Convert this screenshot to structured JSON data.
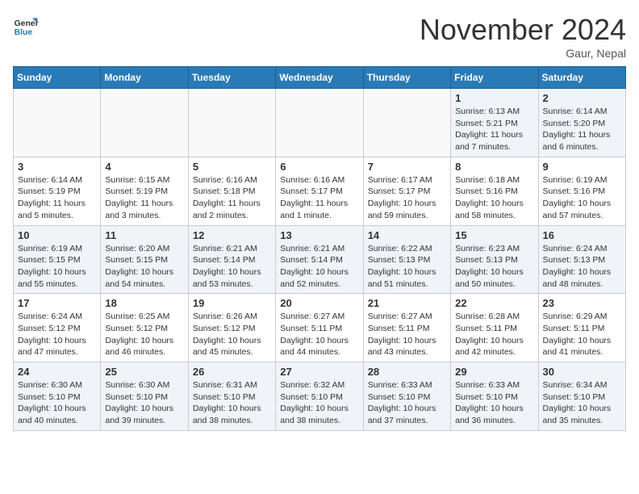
{
  "header": {
    "logo_general": "General",
    "logo_blue": "Blue",
    "month_title": "November 2024",
    "location": "Gaur, Nepal"
  },
  "weekdays": [
    "Sunday",
    "Monday",
    "Tuesday",
    "Wednesday",
    "Thursday",
    "Friday",
    "Saturday"
  ],
  "weeks": [
    [
      {
        "day": "",
        "empty": true
      },
      {
        "day": "",
        "empty": true
      },
      {
        "day": "",
        "empty": true
      },
      {
        "day": "",
        "empty": true
      },
      {
        "day": "",
        "empty": true
      },
      {
        "day": "1",
        "sunrise": "Sunrise: 6:13 AM",
        "sunset": "Sunset: 5:21 PM",
        "daylight": "Daylight: 11 hours and 7 minutes."
      },
      {
        "day": "2",
        "sunrise": "Sunrise: 6:14 AM",
        "sunset": "Sunset: 5:20 PM",
        "daylight": "Daylight: 11 hours and 6 minutes."
      }
    ],
    [
      {
        "day": "3",
        "sunrise": "Sunrise: 6:14 AM",
        "sunset": "Sunset: 5:19 PM",
        "daylight": "Daylight: 11 hours and 5 minutes."
      },
      {
        "day": "4",
        "sunrise": "Sunrise: 6:15 AM",
        "sunset": "Sunset: 5:19 PM",
        "daylight": "Daylight: 11 hours and 3 minutes."
      },
      {
        "day": "5",
        "sunrise": "Sunrise: 6:16 AM",
        "sunset": "Sunset: 5:18 PM",
        "daylight": "Daylight: 11 hours and 2 minutes."
      },
      {
        "day": "6",
        "sunrise": "Sunrise: 6:16 AM",
        "sunset": "Sunset: 5:17 PM",
        "daylight": "Daylight: 11 hours and 1 minute."
      },
      {
        "day": "7",
        "sunrise": "Sunrise: 6:17 AM",
        "sunset": "Sunset: 5:17 PM",
        "daylight": "Daylight: 10 hours and 59 minutes."
      },
      {
        "day": "8",
        "sunrise": "Sunrise: 6:18 AM",
        "sunset": "Sunset: 5:16 PM",
        "daylight": "Daylight: 10 hours and 58 minutes."
      },
      {
        "day": "9",
        "sunrise": "Sunrise: 6:19 AM",
        "sunset": "Sunset: 5:16 PM",
        "daylight": "Daylight: 10 hours and 57 minutes."
      }
    ],
    [
      {
        "day": "10",
        "sunrise": "Sunrise: 6:19 AM",
        "sunset": "Sunset: 5:15 PM",
        "daylight": "Daylight: 10 hours and 55 minutes."
      },
      {
        "day": "11",
        "sunrise": "Sunrise: 6:20 AM",
        "sunset": "Sunset: 5:15 PM",
        "daylight": "Daylight: 10 hours and 54 minutes."
      },
      {
        "day": "12",
        "sunrise": "Sunrise: 6:21 AM",
        "sunset": "Sunset: 5:14 PM",
        "daylight": "Daylight: 10 hours and 53 minutes."
      },
      {
        "day": "13",
        "sunrise": "Sunrise: 6:21 AM",
        "sunset": "Sunset: 5:14 PM",
        "daylight": "Daylight: 10 hours and 52 minutes."
      },
      {
        "day": "14",
        "sunrise": "Sunrise: 6:22 AM",
        "sunset": "Sunset: 5:13 PM",
        "daylight": "Daylight: 10 hours and 51 minutes."
      },
      {
        "day": "15",
        "sunrise": "Sunrise: 6:23 AM",
        "sunset": "Sunset: 5:13 PM",
        "daylight": "Daylight: 10 hours and 50 minutes."
      },
      {
        "day": "16",
        "sunrise": "Sunrise: 6:24 AM",
        "sunset": "Sunset: 5:13 PM",
        "daylight": "Daylight: 10 hours and 48 minutes."
      }
    ],
    [
      {
        "day": "17",
        "sunrise": "Sunrise: 6:24 AM",
        "sunset": "Sunset: 5:12 PM",
        "daylight": "Daylight: 10 hours and 47 minutes."
      },
      {
        "day": "18",
        "sunrise": "Sunrise: 6:25 AM",
        "sunset": "Sunset: 5:12 PM",
        "daylight": "Daylight: 10 hours and 46 minutes."
      },
      {
        "day": "19",
        "sunrise": "Sunrise: 6:26 AM",
        "sunset": "Sunset: 5:12 PM",
        "daylight": "Daylight: 10 hours and 45 minutes."
      },
      {
        "day": "20",
        "sunrise": "Sunrise: 6:27 AM",
        "sunset": "Sunset: 5:11 PM",
        "daylight": "Daylight: 10 hours and 44 minutes."
      },
      {
        "day": "21",
        "sunrise": "Sunrise: 6:27 AM",
        "sunset": "Sunset: 5:11 PM",
        "daylight": "Daylight: 10 hours and 43 minutes."
      },
      {
        "day": "22",
        "sunrise": "Sunrise: 6:28 AM",
        "sunset": "Sunset: 5:11 PM",
        "daylight": "Daylight: 10 hours and 42 minutes."
      },
      {
        "day": "23",
        "sunrise": "Sunrise: 6:29 AM",
        "sunset": "Sunset: 5:11 PM",
        "daylight": "Daylight: 10 hours and 41 minutes."
      }
    ],
    [
      {
        "day": "24",
        "sunrise": "Sunrise: 6:30 AM",
        "sunset": "Sunset: 5:10 PM",
        "daylight": "Daylight: 10 hours and 40 minutes."
      },
      {
        "day": "25",
        "sunrise": "Sunrise: 6:30 AM",
        "sunset": "Sunset: 5:10 PM",
        "daylight": "Daylight: 10 hours and 39 minutes."
      },
      {
        "day": "26",
        "sunrise": "Sunrise: 6:31 AM",
        "sunset": "Sunset: 5:10 PM",
        "daylight": "Daylight: 10 hours and 38 minutes."
      },
      {
        "day": "27",
        "sunrise": "Sunrise: 6:32 AM",
        "sunset": "Sunset: 5:10 PM",
        "daylight": "Daylight: 10 hours and 38 minutes."
      },
      {
        "day": "28",
        "sunrise": "Sunrise: 6:33 AM",
        "sunset": "Sunset: 5:10 PM",
        "daylight": "Daylight: 10 hours and 37 minutes."
      },
      {
        "day": "29",
        "sunrise": "Sunrise: 6:33 AM",
        "sunset": "Sunset: 5:10 PM",
        "daylight": "Daylight: 10 hours and 36 minutes."
      },
      {
        "day": "30",
        "sunrise": "Sunrise: 6:34 AM",
        "sunset": "Sunset: 5:10 PM",
        "daylight": "Daylight: 10 hours and 35 minutes."
      }
    ]
  ]
}
